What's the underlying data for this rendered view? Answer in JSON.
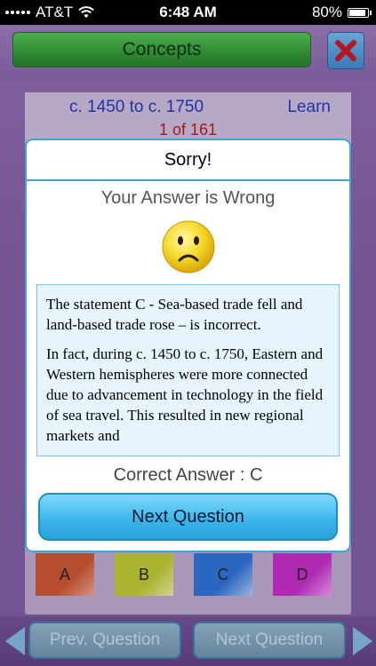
{
  "status_bar": {
    "carrier": "AT&T",
    "time": "6:48 AM",
    "battery_percent": "80%",
    "battery_level": 0.8
  },
  "header": {
    "concepts_label": "Concepts",
    "close_icon": "close-x-icon"
  },
  "card": {
    "period": "c. 1450 to c. 1750",
    "learn_label": "Learn",
    "progress": "1 of 161",
    "choices": [
      "A",
      "B",
      "C",
      "D"
    ]
  },
  "dialog": {
    "title": "Sorry!",
    "result": "Your Answer is Wrong",
    "icon": "sad-face-icon",
    "explanation": [
      "The statement C - Sea-based trade fell and land-based trade rose – is incorrect.",
      "In fact, during c. 1450 to c. 1750, Eastern and Western hemispheres were more connected due to advancement in technology in the field of sea travel. This resulted in new regional markets and"
    ],
    "correct_answer": "Correct Answer : C",
    "next_button": "Next Question"
  },
  "bottom_nav": {
    "prev_label": "Prev. Question",
    "next_label": "Next Question"
  },
  "colors": {
    "background": "#7e5a9e",
    "concepts_button": "#2f9a2f",
    "dialog_border": "#3aa6d8",
    "link": "#1a36b0",
    "progress": "#b01a1a",
    "next_button": "#39b4ea"
  }
}
